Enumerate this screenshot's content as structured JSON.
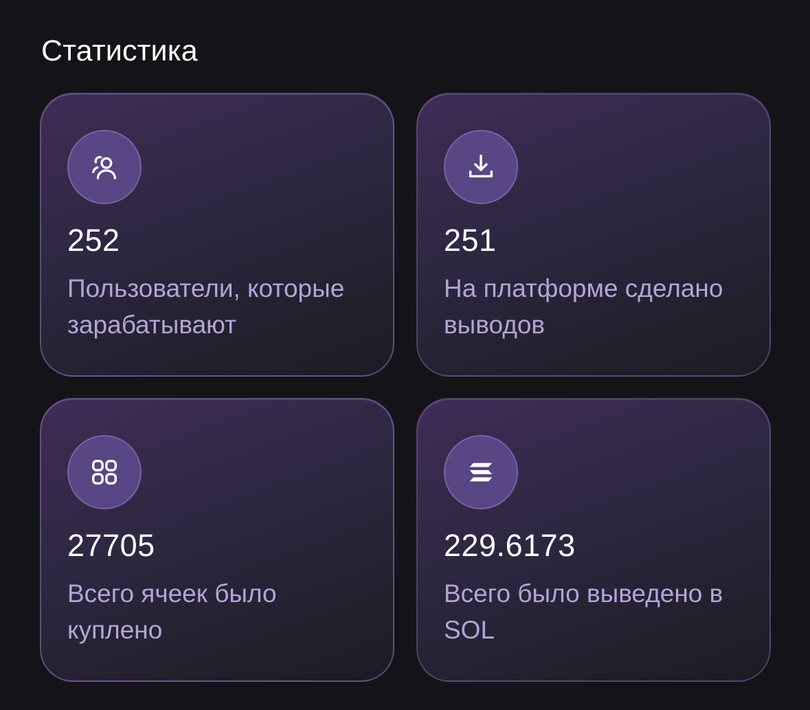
{
  "section": {
    "title": "Статистика"
  },
  "stats": [
    {
      "icon": "users-icon",
      "value": "252",
      "label": "Пользователи, которые зарабатывают"
    },
    {
      "icon": "download-icon",
      "value": "251",
      "label": "На платформе сделано выводов"
    },
    {
      "icon": "grid-icon",
      "value": "27705",
      "label": "Всего ячеек было куплено"
    },
    {
      "icon": "solana-icon",
      "value": "229.6173",
      "label": "Всего было выведено в SOL"
    }
  ],
  "colors": {
    "background": "#141418",
    "icon_circle": "#594684",
    "label_text": "#b3a5d6",
    "value_text": "#ffffff"
  }
}
